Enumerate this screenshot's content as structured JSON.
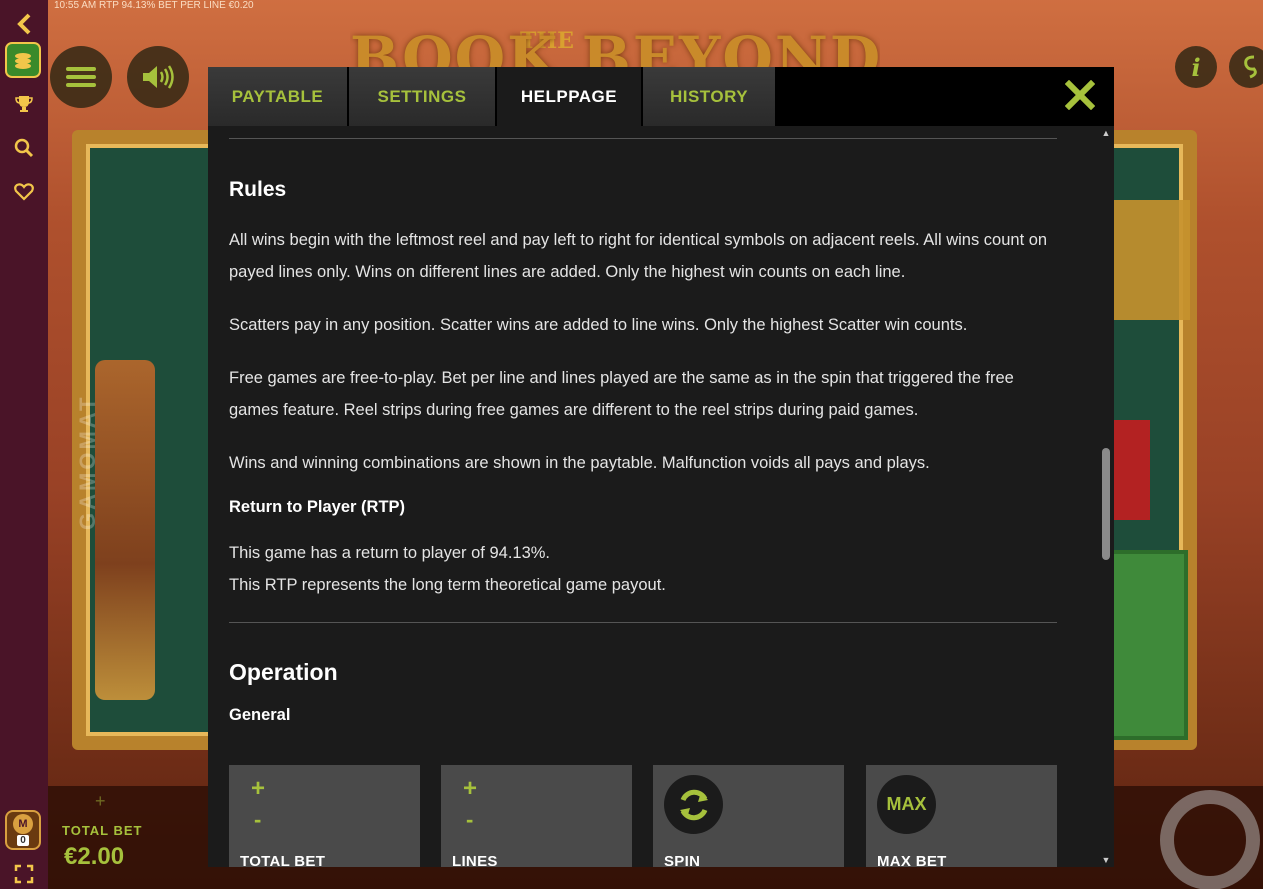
{
  "status_bar": {
    "time": "10:55 AM",
    "rtp": "RTP 94.13%",
    "bet_per_line": "BET PER LINE €0.20"
  },
  "game": {
    "logo_small": "THE",
    "logo_main": "BOOK BEYOND II",
    "provider_vertical": "GAMOMAT"
  },
  "sidebar": {
    "items": [
      {
        "icon": "chevron-left-icon"
      },
      {
        "icon": "coins-icon"
      },
      {
        "icon": "trophy-icon"
      },
      {
        "icon": "search-icon"
      },
      {
        "icon": "heart-icon"
      }
    ],
    "level_badge": {
      "letter": "M",
      "count": "0"
    },
    "fullscreen_icon": "fullscreen-icon"
  },
  "floating_buttons": {
    "menu_icon": "hamburger-icon",
    "sound_icon": "speaker-icon",
    "info_label": "i"
  },
  "bottom_bar": {
    "total_bet_label": "TOTAL BET",
    "total_bet_value": "€2.00"
  },
  "modal": {
    "tabs": [
      {
        "label": "PAYTABLE",
        "active": false
      },
      {
        "label": "SETTINGS",
        "active": false
      },
      {
        "label": "HELPPAGE",
        "active": true
      },
      {
        "label": "HISTORY",
        "active": false
      }
    ],
    "close_icon": "close-icon",
    "content": {
      "rules_title": "Rules",
      "rules_p1": "All wins begin with the leftmost reel and pay left to right for identical symbols on adjacent reels. All wins count on payed lines only. Wins on different lines are added. Only the highest win counts on each line.",
      "rules_p2": "Scatters pay in any position. Scatter wins are added to line wins. Only the highest Scatter win counts.",
      "rules_p3": "Free games are free-to-play. Bet per line and lines played are the same as in the spin that triggered the free games feature. Reel strips during free games are different to the reel strips during paid games.",
      "rules_p4": "Wins and winning combinations are shown in the paytable. Malfunction voids all pays and plays.",
      "rtp_title": "Return to Player (RTP)",
      "rtp_line1": "This game has a return to player of 94.13%.",
      "rtp_line2": "This RTP represents the long term theoretical game payout.",
      "operation_title": "Operation",
      "general_title": "General",
      "cards": [
        {
          "plus": "+",
          "minus": "-",
          "label": "TOTAL BET"
        },
        {
          "plus": "+",
          "minus": "-",
          "label": "LINES"
        },
        {
          "icon": "refresh-icon",
          "label": "SPIN"
        },
        {
          "circle_text": "MAX",
          "label": "MAX BET"
        }
      ]
    }
  }
}
